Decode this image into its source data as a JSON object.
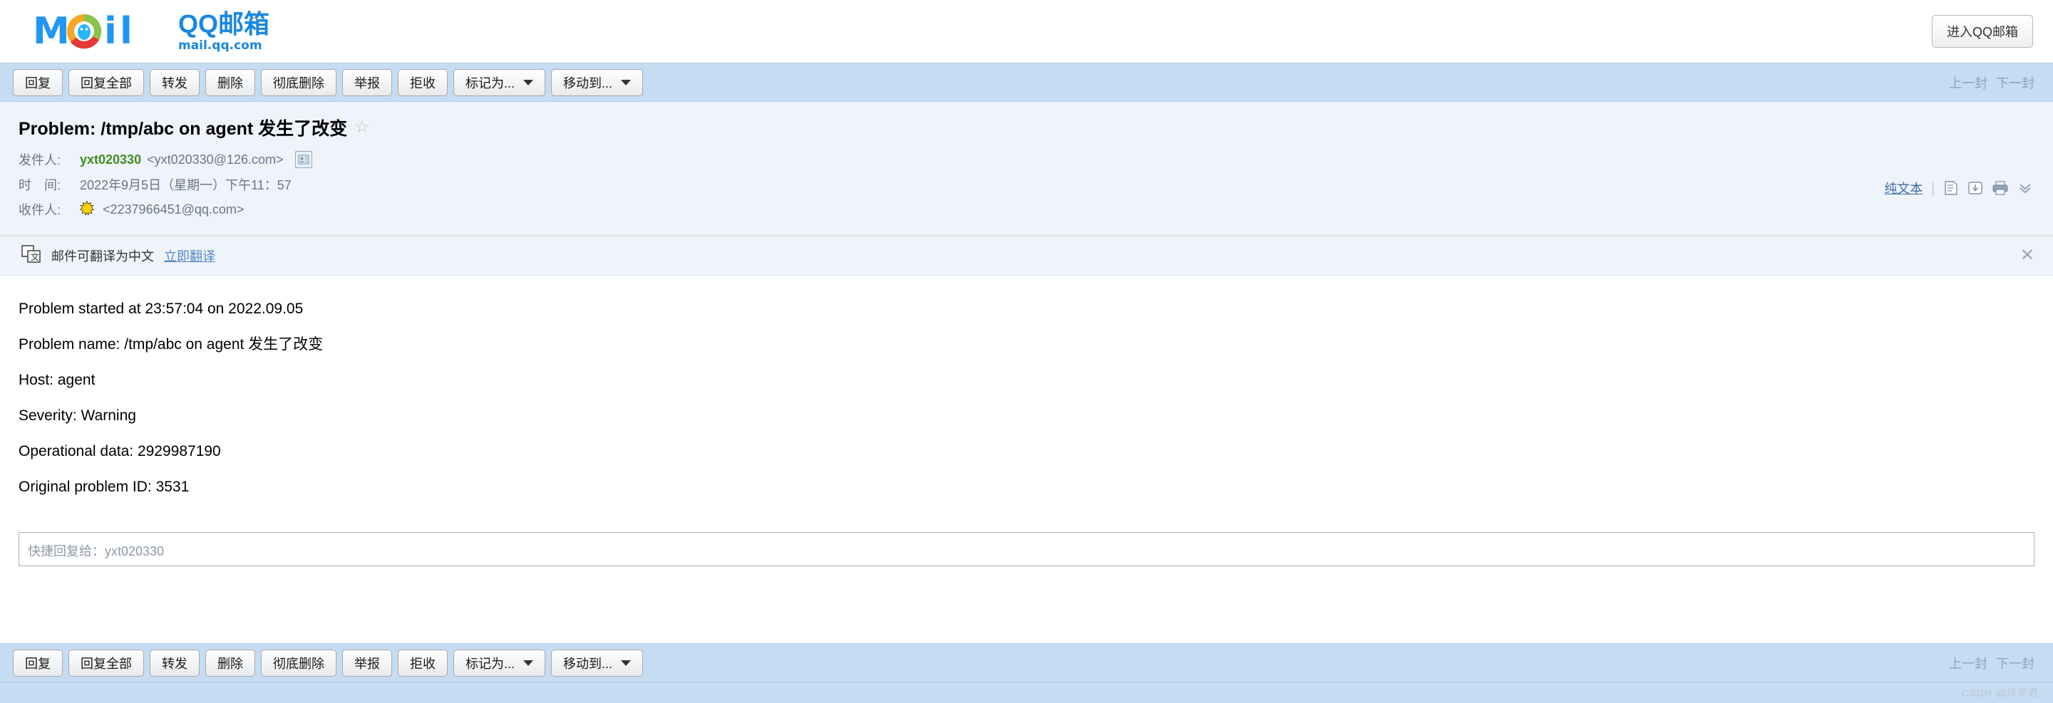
{
  "brand": {
    "logo_alt": "Mail",
    "name_cn": "QQ邮箱",
    "url": "mail.qq.com",
    "enter_button": "进入QQ邮箱"
  },
  "toolbar": {
    "buttons": [
      {
        "label": "回复",
        "dropdown": false
      },
      {
        "label": "回复全部",
        "dropdown": false
      },
      {
        "label": "转发",
        "dropdown": false
      },
      {
        "label": "删除",
        "dropdown": false
      },
      {
        "label": "彻底删除",
        "dropdown": false
      },
      {
        "label": "举报",
        "dropdown": false
      },
      {
        "label": "拒收",
        "dropdown": false
      },
      {
        "label": "标记为...",
        "dropdown": true
      },
      {
        "label": "移动到...",
        "dropdown": true
      }
    ],
    "prev_label": "上一封",
    "next_label": "下一封"
  },
  "mail": {
    "subject": "Problem: /tmp/abc on agent 发生了改变",
    "star_glyph": "☆",
    "sender_label": "发件人:",
    "sender_name": "yxt020330",
    "sender_address": "<yxt020330@126.com>",
    "time_label": "时　间:",
    "time_value": "2022年9月5日（星期一）下午11：57",
    "to_label": "收件人:",
    "to_address": "<2237966451@qq.com>",
    "plain_text_link": "纯文本"
  },
  "translate": {
    "message": "邮件可翻译为中文",
    "action": "立即翻译",
    "close_glyph": "✕"
  },
  "body": {
    "lines": [
      "Problem started at 23:57:04 on 2022.09.05",
      "Problem name: /tmp/abc on agent 发生了改变",
      "Host: agent",
      "Severity: Warning",
      "Operational data: 2929987190",
      "Original problem ID: 3531"
    ]
  },
  "quick_reply": {
    "placeholder": "快捷回复给：yxt020330",
    "value": ""
  },
  "watermark": "CSDN @风早君",
  "colors": {
    "toolbar_bg": "#c6dcf2",
    "header_bg": "#eff3fa",
    "brand_blue": "#1a87e0",
    "sender_green": "#3f8f1f",
    "link_blue": "#5588c4"
  }
}
